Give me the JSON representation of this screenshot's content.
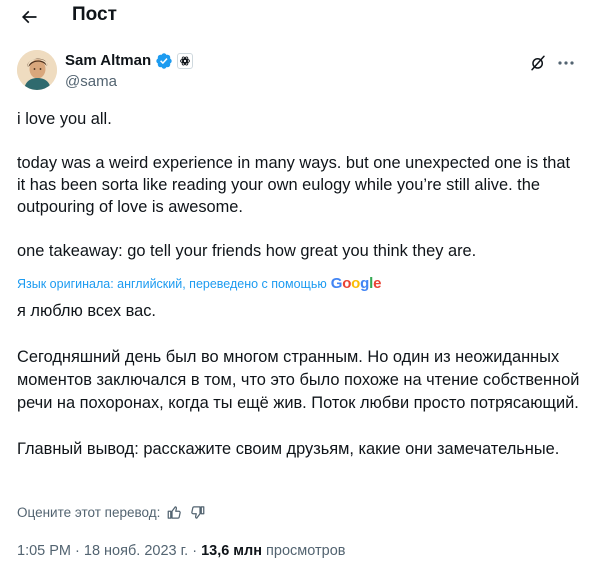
{
  "header": {
    "title": "Пост"
  },
  "author": {
    "display_name": "Sam Altman",
    "handle": "@sama",
    "verified_color": "#1d9bf0"
  },
  "tweet": {
    "paragraphs": [
      "i love you all.",
      "today was a weird experience in many ways. but one unexpected one is that it has been sorta like reading your own eulogy while you’re still alive. the outpouring of love is awesome.",
      "one takeaway: go tell your friends how great you think they are."
    ]
  },
  "translation": {
    "note": "Язык оригинала: английский, переведено с помощью",
    "provider": "Google",
    "paragraphs": [
      "я люблю всех вас.",
      "Сегодняшний день был во многом странным. Но один из неожиданных моментов заключался в том, что это было похоже на чтение собственной речи на похоронах, когда ты ещё жив. Поток любви просто потрясающий.",
      "Главный вывод: расскажите своим друзьям, какие они замечательные."
    ],
    "rate_label": "Оцените этот перевод:"
  },
  "meta": {
    "time": "1:05 PM",
    "separator": " · ",
    "date": "18 нояб. 2023 г.",
    "views_count": "13,6 млн",
    "views_label": " просмотров"
  },
  "icons": {
    "back": "arrow-left-icon",
    "verified": "verified-badge-icon",
    "affiliate": "openai-affiliate-icon",
    "grok": "grok-icon",
    "more": "more-dots-icon",
    "thumbs_up": "thumbs-up-icon",
    "thumbs_down": "thumbs-down-icon"
  }
}
